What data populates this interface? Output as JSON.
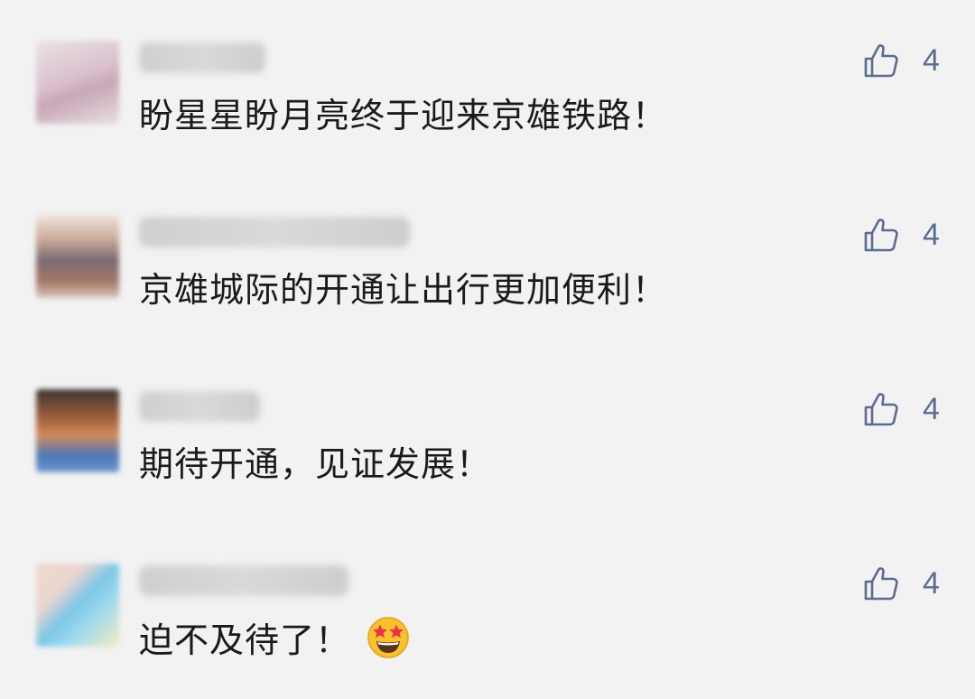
{
  "comments": [
    {
      "text": "盼星星盼月亮终于迎来京雄铁路！",
      "likes": "4"
    },
    {
      "text": "京雄城际的开通让出行更加便利！",
      "likes": "4"
    },
    {
      "text": "期待开通，见证发展！",
      "likes": "4"
    },
    {
      "text": "迫不及待了！",
      "likes": "4",
      "emoji": "star-struck-emoji"
    }
  ],
  "colors": {
    "background": "#f2f2f2",
    "like_accent": "#5b6c91",
    "text": "#1a1a1a"
  },
  "icons": {
    "like": "thumbs-up-icon"
  }
}
